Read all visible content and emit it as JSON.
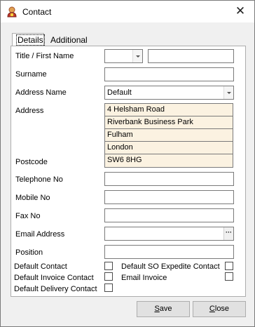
{
  "window": {
    "title": "Contact",
    "close_symbol": "✕"
  },
  "tabs": [
    {
      "label": "Details",
      "active": true
    },
    {
      "label": "Additional Info",
      "active": false
    }
  ],
  "form": {
    "title_first_name_label": "Title / First Name",
    "title_value": "",
    "first_name_value": "",
    "surname_label": "Surname",
    "surname_value": "",
    "address_name_label": "Address Name",
    "address_name_value": "Default",
    "address_label": "Address",
    "address_lines": [
      "4 Helsham Road",
      "Riverbank Business Park",
      "Fulham",
      "London",
      "SW6 8HG"
    ],
    "postcode_label": "Postcode",
    "telephone_label": "Telephone No",
    "telephone_value": "",
    "mobile_label": "Mobile No",
    "mobile_value": "",
    "fax_label": "Fax No",
    "fax_value": "",
    "email_label": "Email Address",
    "email_value": "",
    "email_button": "···",
    "position_label": "Position",
    "position_value": ""
  },
  "checkboxes": {
    "default_contact": {
      "label": "Default Contact",
      "checked": false
    },
    "default_invoice_contact": {
      "label": "Default Invoice Contact",
      "checked": false
    },
    "default_delivery_contact": {
      "label": "Default Delivery Contact",
      "checked": false
    },
    "default_so_expedite_contact": {
      "label": "Default SO Expedite Contact",
      "checked": false
    },
    "email_invoice": {
      "label": "Email Invoice",
      "checked": false
    }
  },
  "buttons": {
    "save": {
      "mnemonic": "S",
      "rest": "ave"
    },
    "close": {
      "mnemonic": "C",
      "rest": "lose"
    }
  }
}
